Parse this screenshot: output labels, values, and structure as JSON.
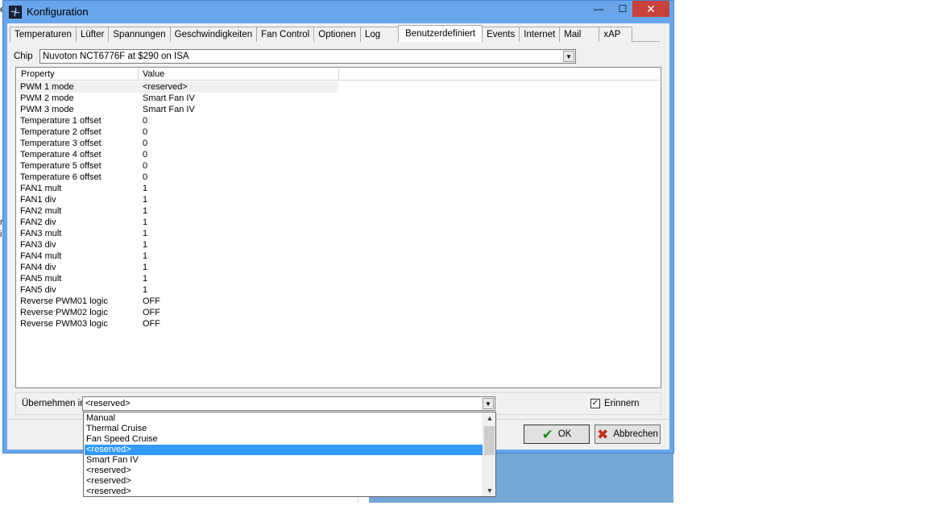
{
  "window": {
    "title": "Konfiguration"
  },
  "titlebar": {
    "minimize": "—",
    "maximize": "☐",
    "close": "✕"
  },
  "tabs": [
    {
      "label": "Temperaturen",
      "active": false
    },
    {
      "label": "Lüfter",
      "active": false
    },
    {
      "label": "Spannungen",
      "active": false
    },
    {
      "label": "Geschwindigkeiten",
      "active": false
    },
    {
      "label": "Fan Control",
      "active": false
    },
    {
      "label": "Optionen",
      "active": false
    },
    {
      "label": "Log",
      "active": false
    },
    {
      "label": "Benutzerdefiniert",
      "active": true
    },
    {
      "label": "Events",
      "active": false
    },
    {
      "label": "Internet",
      "active": false
    },
    {
      "label": "Mail",
      "active": false
    },
    {
      "label": "xAP",
      "active": false
    }
  ],
  "chip": {
    "label": "Chip",
    "value": "Nuvoton NCT6776F at $290 on ISA"
  },
  "list": {
    "headers": {
      "property": "Property",
      "value": "Value"
    },
    "rows": [
      {
        "property": "PWM 1 mode",
        "value": "<reserved>"
      },
      {
        "property": "PWM 2 mode",
        "value": "Smart Fan IV"
      },
      {
        "property": "PWM 3 mode",
        "value": "Smart Fan IV"
      },
      {
        "property": "Temperature 1 offset",
        "value": "0"
      },
      {
        "property": "Temperature 2 offset",
        "value": "0"
      },
      {
        "property": "Temperature 3 offset",
        "value": "0"
      },
      {
        "property": "Temperature 4 offset",
        "value": "0"
      },
      {
        "property": "Temperature 5 offset",
        "value": "0"
      },
      {
        "property": "Temperature 6 offset",
        "value": "0"
      },
      {
        "property": "FAN1 mult",
        "value": "1"
      },
      {
        "property": "FAN1 div",
        "value": "1"
      },
      {
        "property": "FAN2 mult",
        "value": "1"
      },
      {
        "property": "FAN2 div",
        "value": "1"
      },
      {
        "property": "FAN3 mult",
        "value": "1"
      },
      {
        "property": "FAN3 div",
        "value": "1"
      },
      {
        "property": "FAN4 mult",
        "value": "1"
      },
      {
        "property": "FAN4 div",
        "value": "1"
      },
      {
        "property": "FAN5 mult",
        "value": "1"
      },
      {
        "property": "FAN5 div",
        "value": "1"
      },
      {
        "property": "Reverse PWM01 logic",
        "value": "OFF"
      },
      {
        "property": "Reverse PWM02 logic",
        "value": "OFF"
      },
      {
        "property": "Reverse PWM03 logic",
        "value": "OFF"
      }
    ]
  },
  "apply": {
    "label": "Übernehmen in",
    "value": "<reserved>",
    "options": [
      "Manual",
      "Thermal Cruise",
      "Fan Speed Cruise",
      "<reserved>",
      "Smart Fan IV",
      "<reserved>",
      "<reserved>",
      "<reserved>"
    ],
    "highlighted_index": 3
  },
  "remember": {
    "label": "Erinnern",
    "checked": true,
    "mark": "✓"
  },
  "buttons": {
    "ok": "OK",
    "cancel": "Abbrechen"
  },
  "background_fragments": [
    "e",
    "r",
    "i"
  ]
}
